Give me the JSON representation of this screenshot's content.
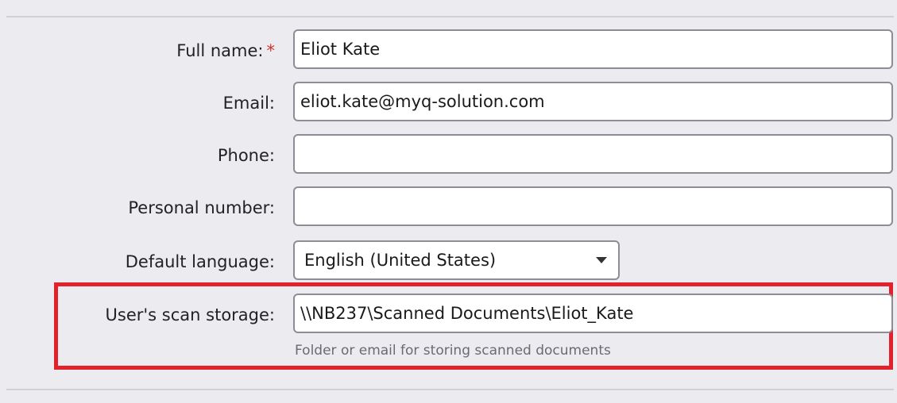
{
  "form": {
    "full_name": {
      "label": "Full name:",
      "required_mark": "*",
      "value": "Eliot Kate"
    },
    "email": {
      "label": "Email:",
      "value": "eliot.kate@myq-solution.com"
    },
    "phone": {
      "label": "Phone:",
      "value": ""
    },
    "personal_number": {
      "label": "Personal number:",
      "value": ""
    },
    "default_language": {
      "label": "Default language:",
      "selected": "English (United States)"
    },
    "scan_storage": {
      "label": "User's scan storage:",
      "value": "\\\\NB237\\Scanned Documents\\Eliot_Kate",
      "hint": "Folder or email for storing scanned documents"
    }
  },
  "colors": {
    "background": "#ebebf0",
    "highlight_border": "#e3212b",
    "required_mark": "#d0342c",
    "input_border": "#8d8d95"
  },
  "icons": {
    "dropdown": "chevron-down-icon"
  }
}
